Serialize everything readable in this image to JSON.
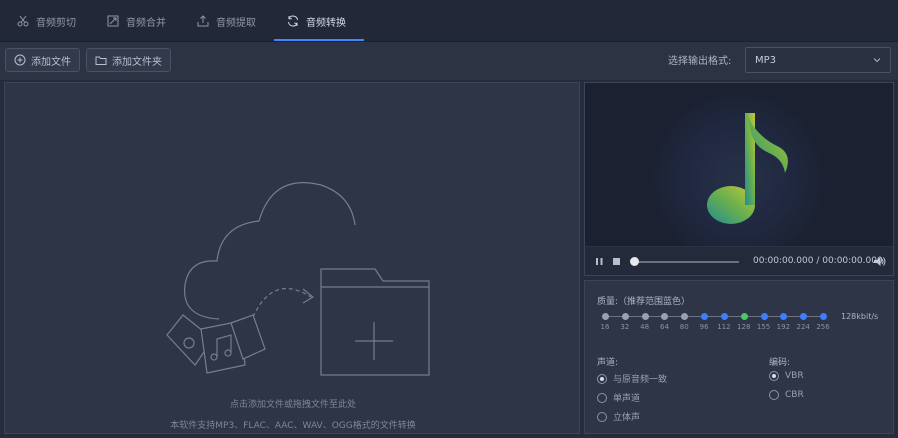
{
  "tabs": [
    {
      "label": "音频剪切",
      "icon": "scissors-icon"
    },
    {
      "label": "音频合并",
      "icon": "merge-icon"
    },
    {
      "label": "音频提取",
      "icon": "extract-icon"
    },
    {
      "label": "音频转换",
      "icon": "convert-icon"
    }
  ],
  "active_tab": 3,
  "toolbar": {
    "add_file_label": "添加文件",
    "add_folder_label": "添加文件夹",
    "format_label": "选择输出格式:",
    "format_value": "MP3"
  },
  "drop_area": {
    "hint_line1": "点击添加文件或拖拽文件至此处",
    "hint_line2": "本软件支持MP3、FLAC、AAC、WAV、OGG格式的文件转换"
  },
  "player": {
    "time_display": "00:00:00.000 / 00:00:00.000",
    "progress": 0
  },
  "settings": {
    "quality_label": "质量:（推荐范围蓝色）",
    "quality_ticks": [
      "16",
      "32",
      "48",
      "64",
      "80",
      "96",
      "112",
      "128",
      "155",
      "192",
      "224",
      "256"
    ],
    "quality_selected_index": 7,
    "quality_value": "128kbit/s",
    "channel_label": "声道:",
    "channel_options": [
      "与原音频一致",
      "单声道",
      "立体声"
    ],
    "channel_selected": 0,
    "encoding_label": "编码:",
    "encoding_options": [
      "VBR",
      "CBR"
    ],
    "encoding_selected": 0
  },
  "colors": {
    "accent": "#3f86ff",
    "selected_quality": "#49c86a",
    "recommended_quality": "#3f7dff"
  }
}
